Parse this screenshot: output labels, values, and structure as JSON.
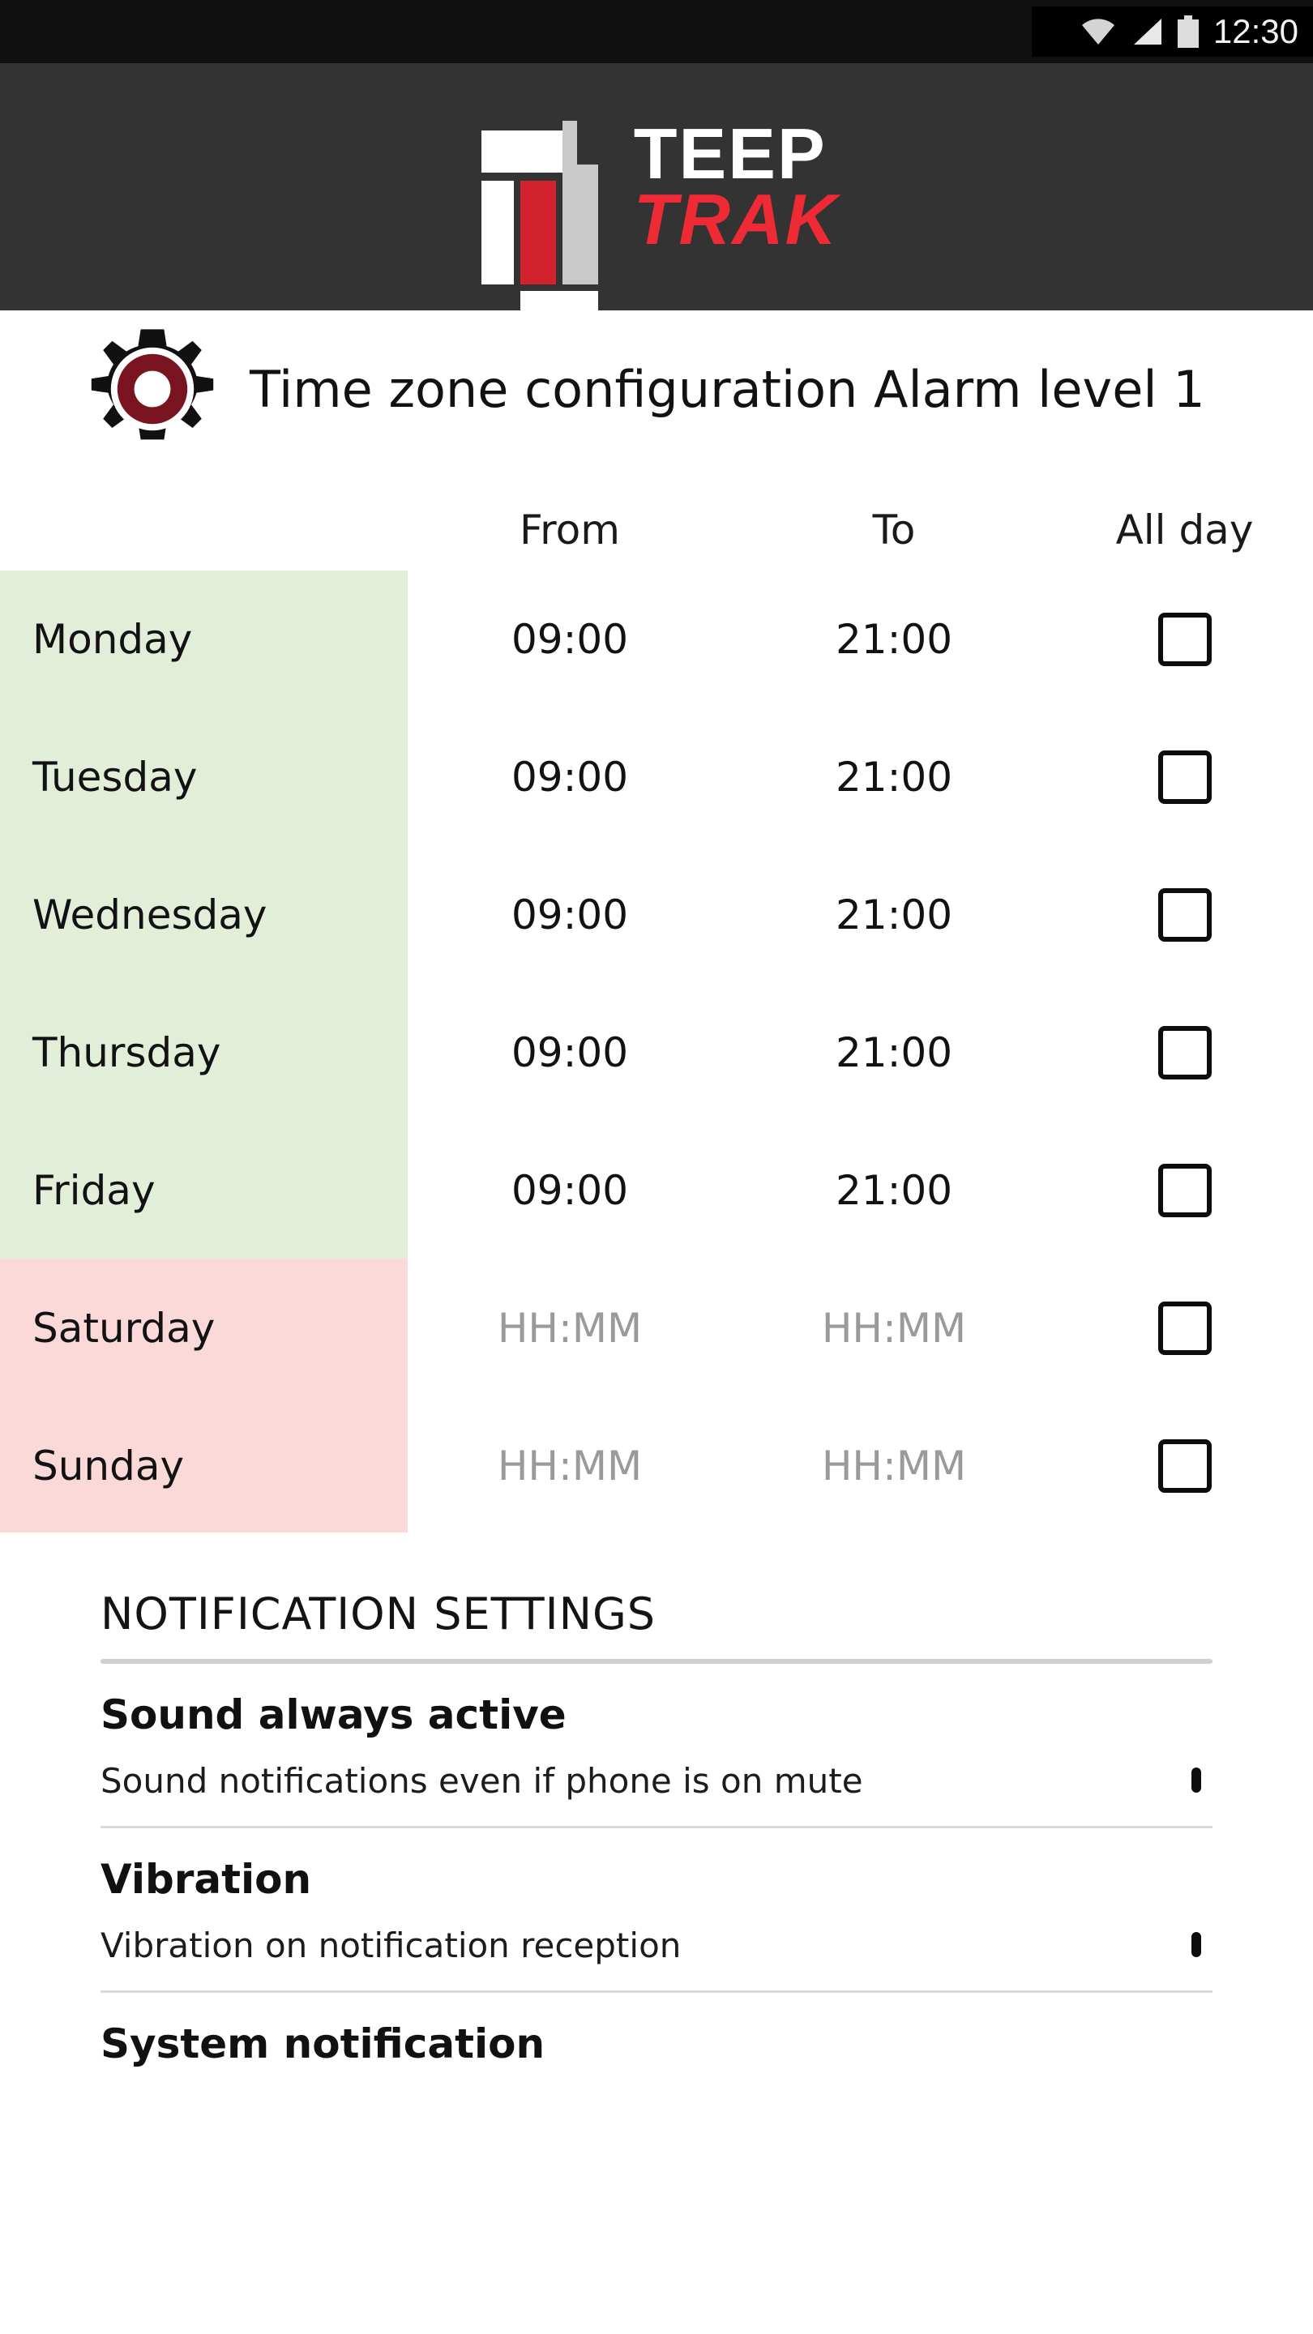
{
  "statusbar": {
    "time": "12:30",
    "icons": [
      "wifi-icon",
      "cellular-signal-icon",
      "battery-icon"
    ]
  },
  "brand": {
    "line1": "TEEP",
    "line2": "TRAK",
    "colors": {
      "bar_red": "#d2222e",
      "word_red": "#ee2a34",
      "header_bg": "#333333"
    }
  },
  "header": {
    "icon": "gear-icon",
    "title": "Time zone configuration Alarm level 1"
  },
  "schedule": {
    "columns": {
      "day": "",
      "from": "From",
      "to": "To",
      "all_day": "All day"
    },
    "weekday_bg": "#e3eed9",
    "weekend_bg": "#fbd9d9",
    "placeholder": "HH:MM",
    "rows": [
      {
        "day": "Monday",
        "from": "09:00",
        "to": "21:00",
        "all_day": false,
        "kind": "weekday"
      },
      {
        "day": "Tuesday",
        "from": "09:00",
        "to": "21:00",
        "all_day": false,
        "kind": "weekday"
      },
      {
        "day": "Wednesday",
        "from": "09:00",
        "to": "21:00",
        "all_day": false,
        "kind": "weekday"
      },
      {
        "day": "Thursday",
        "from": "09:00",
        "to": "21:00",
        "all_day": false,
        "kind": "weekday"
      },
      {
        "day": "Friday",
        "from": "09:00",
        "to": "21:00",
        "all_day": false,
        "kind": "weekday"
      },
      {
        "day": "Saturday",
        "from": "HH:MM",
        "to": "HH:MM",
        "all_day": false,
        "kind": "weekend"
      },
      {
        "day": "Sunday",
        "from": "HH:MM",
        "to": "HH:MM",
        "all_day": false,
        "kind": "weekend"
      }
    ]
  },
  "notifications": {
    "section_title": "NOTIFICATION SETTINGS",
    "items": [
      {
        "title": "Sound always active",
        "description": "Sound notifications even if phone is on mute",
        "checked": false
      },
      {
        "title": "Vibration",
        "description": "Vibration on notification reception",
        "checked": false
      },
      {
        "title": "System notification",
        "description": "",
        "checked": false
      }
    ]
  }
}
